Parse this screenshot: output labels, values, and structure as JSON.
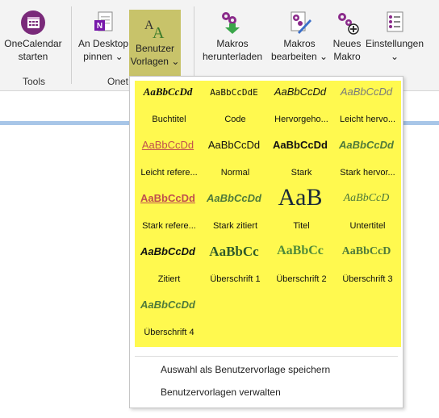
{
  "ribbon": {
    "buttons": [
      {
        "line1": "OneCalendar",
        "line2": "starten"
      },
      {
        "line1": "An Desktop",
        "line2": "pinnen ⌄"
      },
      {
        "line1": "Benutzer",
        "line2": "Vorlagen ⌄"
      },
      {
        "line1": "Makros",
        "line2": "herunterladen"
      },
      {
        "line1": "Makros",
        "line2": "bearbeiten ⌄"
      },
      {
        "line1": "Neues",
        "line2": "Makro"
      },
      {
        "line1": "Einstellungen",
        "line2": "⌄"
      }
    ],
    "groups": {
      "tools": "Tools",
      "onetastic": "Onet"
    }
  },
  "gallery": {
    "items": [
      {
        "preview": "AaBbCcDd",
        "name": "Buchtitel"
      },
      {
        "preview": "AaBbCcDdE",
        "name": "Code"
      },
      {
        "preview": "AaBbCcDd",
        "name": "Hervorgeho..."
      },
      {
        "preview": "AaBbCcDd",
        "name": "Leicht hervo..."
      },
      {
        "preview": "AaBbCcDd",
        "name": "Leicht refere..."
      },
      {
        "preview": "AaBbCcDd",
        "name": "Normal"
      },
      {
        "preview": "AaBbCcDd",
        "name": "Stark"
      },
      {
        "preview": "AaBbCcDd",
        "name": "Stark hervor..."
      },
      {
        "preview": "AaBbCcDd",
        "name": "Stark refere..."
      },
      {
        "preview": "AaBbCcDd",
        "name": "Stark zitiert"
      },
      {
        "preview": "AaB",
        "name": "Titel"
      },
      {
        "preview": "AaBbCcD",
        "name": "Untertitel"
      },
      {
        "preview": "AaBbCcDd",
        "name": "Zitiert"
      },
      {
        "preview": "AaBbCc",
        "name": "Überschrift 1"
      },
      {
        "preview": "AaBbCc",
        "name": "Überschrift 2"
      },
      {
        "preview": "AaBbCcD",
        "name": "Überschrift 3"
      },
      {
        "preview": "AaBbCcDd",
        "name": "Überschrift 4"
      }
    ],
    "highlight_color": "#fff94f"
  },
  "menu": {
    "save_selection": "Auswahl als Benutzervorlage speichern",
    "manage": "Benutzervorlagen verwalten"
  }
}
